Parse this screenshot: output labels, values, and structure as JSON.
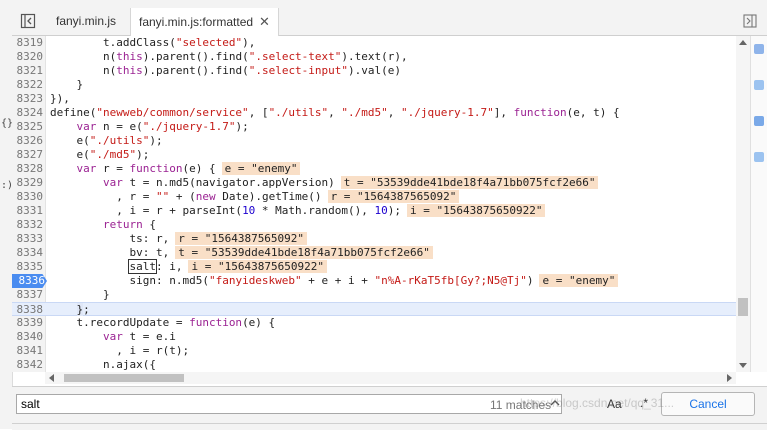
{
  "tabs": [
    {
      "label": "fanyi.min.js",
      "active": false
    },
    {
      "label": "fanyi.min.js:formatted",
      "active": true
    }
  ],
  "left_marks": [
    "{}",
    ":)"
  ],
  "code_lines": [
    {
      "no": "8319",
      "html": "        t.addClass(<span class=\"str\">\"selected\"</span>),"
    },
    {
      "no": "8320",
      "html": "        n(<span class=\"kw\">this</span>).parent().find(<span class=\"str\">\".select-text\"</span>).text(r),"
    },
    {
      "no": "8321",
      "html": "        n(<span class=\"kw\">this</span>).parent().find(<span class=\"str\">\".select-input\"</span>).val(e)"
    },
    {
      "no": "8322",
      "html": "    }"
    },
    {
      "no": "8323",
      "html": "}),"
    },
    {
      "no": "8324",
      "html": "define(<span class=\"str\">\"newweb/common/service\"</span>, [<span class=\"str\">\"./utils\"</span>, <span class=\"str\">\"./md5\"</span>, <span class=\"str\">\"./jquery-1.7\"</span>], <span class=\"kw\">function</span>(e, t) {"
    },
    {
      "no": "8325",
      "html": "    <span class=\"kw\">var</span> n = e(<span class=\"str\">\"./jquery-1.7\"</span>);"
    },
    {
      "no": "8326",
      "html": "    e(<span class=\"str\">\"./utils\"</span>);"
    },
    {
      "no": "8327",
      "html": "    e(<span class=\"str\">\"./md5\"</span>);"
    },
    {
      "no": "8328",
      "html": "    <span class=\"kw\">var</span> r = <span class=\"kw\">function</span>(e) {<span class=\"hint\">e = \"enemy\"</span>"
    },
    {
      "no": "8329",
      "html": "        <span class=\"kw\">var</span> t = n.md5(navigator.appVersion)<span class=\"hint\">t = \"53539dde41bde18f4a71bb075fcf2e66\"</span>"
    },
    {
      "no": "8330",
      "html": "          , r = <span class=\"str\">\"\"</span> + (<span class=\"kw\">new</span> Date).getTime()<span class=\"hint\">r = \"1564387565092\"</span>"
    },
    {
      "no": "8331",
      "html": "          , i = r + parseInt(<span class=\"num\">10</span> * Math.random(), <span class=\"num\">10</span>);<span class=\"hint\">i = \"15643875650922\"</span>"
    },
    {
      "no": "8332",
      "html": "        <span class=\"kw\">return</span> {"
    },
    {
      "no": "8333",
      "html": "            ts: r,<span class=\"hint\">r = \"1564387565092\"</span>"
    },
    {
      "no": "8334",
      "html": "            bv: t,<span class=\"hint\">t = \"53539dde41bde18f4a71bb075fcf2e66\"</span>"
    },
    {
      "no": "8335",
      "html": "            <span class=\"salt\">salt</span>: i,<span class=\"hint\">i = \"15643875650922\"</span>"
    },
    {
      "no": "8336",
      "html": "            sign: n.md5(<span class=\"str\">\"fanyideskweb\"</span> + e + i + <span class=\"str\">\"n%A-rKaT5fb[Gy?;N5@Tj\"</span>)<span class=\"hint\">e = \"enemy\"</span>",
      "breakpoint": true
    },
    {
      "no": "8337",
      "html": "        }"
    },
    {
      "no": "8338",
      "html": "    <span class=\"sel\">}</span>;",
      "current": true
    },
    {
      "no": "8339",
      "html": "    t.recordUpdate = <span class=\"kw\">function</span>(e) {"
    },
    {
      "no": "8340",
      "html": "        <span class=\"kw\">var</span> t = e.i"
    },
    {
      "no": "8341",
      "html": "          , i = r(t);"
    },
    {
      "no": "8342",
      "html": "        n.ajax({"
    },
    {
      "no": "8343",
      "html": ""
    }
  ],
  "search": {
    "value": "salt",
    "match_count": "11 matches",
    "case_label": "Aa",
    "regex_label": ".*",
    "cancel_label": "Cancel"
  },
  "watermark": "https://blog.csdn.net/qq_31..."
}
